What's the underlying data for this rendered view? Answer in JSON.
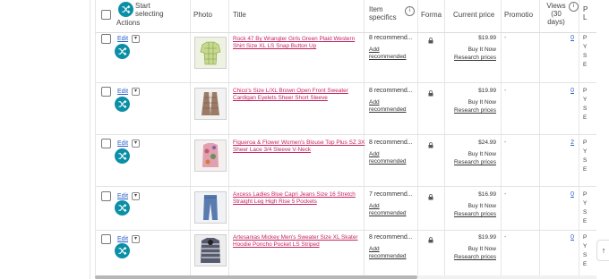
{
  "header": {
    "start_selecting": "Start selecting",
    "actions": "Actions",
    "photo": "Photo",
    "title": "Title",
    "item_specifics": "Item specifics",
    "format": "Forma",
    "current_price": "Current price",
    "promotion": "Promotio",
    "views": "Views (30 days)",
    "last_col": "P L"
  },
  "rows": [
    {
      "edit": "Edit",
      "title": "Rock 47 By Wrangler Girls Green Plaid Western Shirt Size XL LS Snap Button Up",
      "specifics": "8 recommend...",
      "add_recommended": "Add recommended",
      "price": "$19.99",
      "format": "Buy It Now",
      "research": "Research prices",
      "promotion": "-",
      "views": "0",
      "photo_color": "#c7d98f",
      "listcol": [
        "P",
        "Y",
        "S",
        "E"
      ]
    },
    {
      "edit": "Edit",
      "title": "Chico's Size L/XL Brown Open Front Sweater Cardigan Eyelets Sheer Short Sleeve",
      "specifics": "8 recommend...",
      "add_recommended": "Add recommended",
      "price": "$19.99",
      "format": "Buy It Now",
      "research": "Research prices",
      "promotion": "-",
      "views": "0",
      "photo_color": "#9b7b66",
      "listcol": [
        "P",
        "Y",
        "S",
        "E"
      ]
    },
    {
      "edit": "Edit",
      "title": "Figueroa & Flower Women's Blouse Top Plus SZ 3X Sheer Lace 3/4 Sleeve V-Neck",
      "specifics": "8 recommend...",
      "add_recommended": "Add recommended",
      "price": "$24.99",
      "format": "Buy It Now",
      "research": "Research prices",
      "promotion": "-",
      "views": "2",
      "photo_color": "#e0a0b0",
      "listcol": [
        "P",
        "Y",
        "S",
        "E"
      ]
    },
    {
      "edit": "Edit",
      "title": "Axcess Ladies Blue Capri Jeans Size 16 Stretch Straight Leg High Rise 5 Pockets",
      "specifics": "7 recommend...",
      "add_recommended": "Add recommended",
      "price": "$16.99",
      "format": "Buy It Now",
      "research": "Research prices",
      "promotion": "-",
      "views": "0",
      "photo_color": "#5a7bb0",
      "listcol": [
        "P",
        "Y",
        "S",
        "E"
      ]
    },
    {
      "edit": "Edit",
      "title": "Artesanias Mickey Men's Sweater Size XL Skater Hoodie Poncho Pocket LS Striped",
      "specifics": "8 recommend...",
      "add_recommended": "Add recommended",
      "price": "$19.99",
      "format": "Buy It Now",
      "research": "Research prices",
      "promotion": "-",
      "views": "0",
      "photo_color": "#555a6e",
      "listcol": [
        "P",
        "Y",
        "S",
        "E"
      ]
    }
  ],
  "scroll_top_label": "↑",
  "colors": {
    "accent": "#0a8fa6",
    "title_link": "#c4245f",
    "link": "#2a5ec9"
  }
}
